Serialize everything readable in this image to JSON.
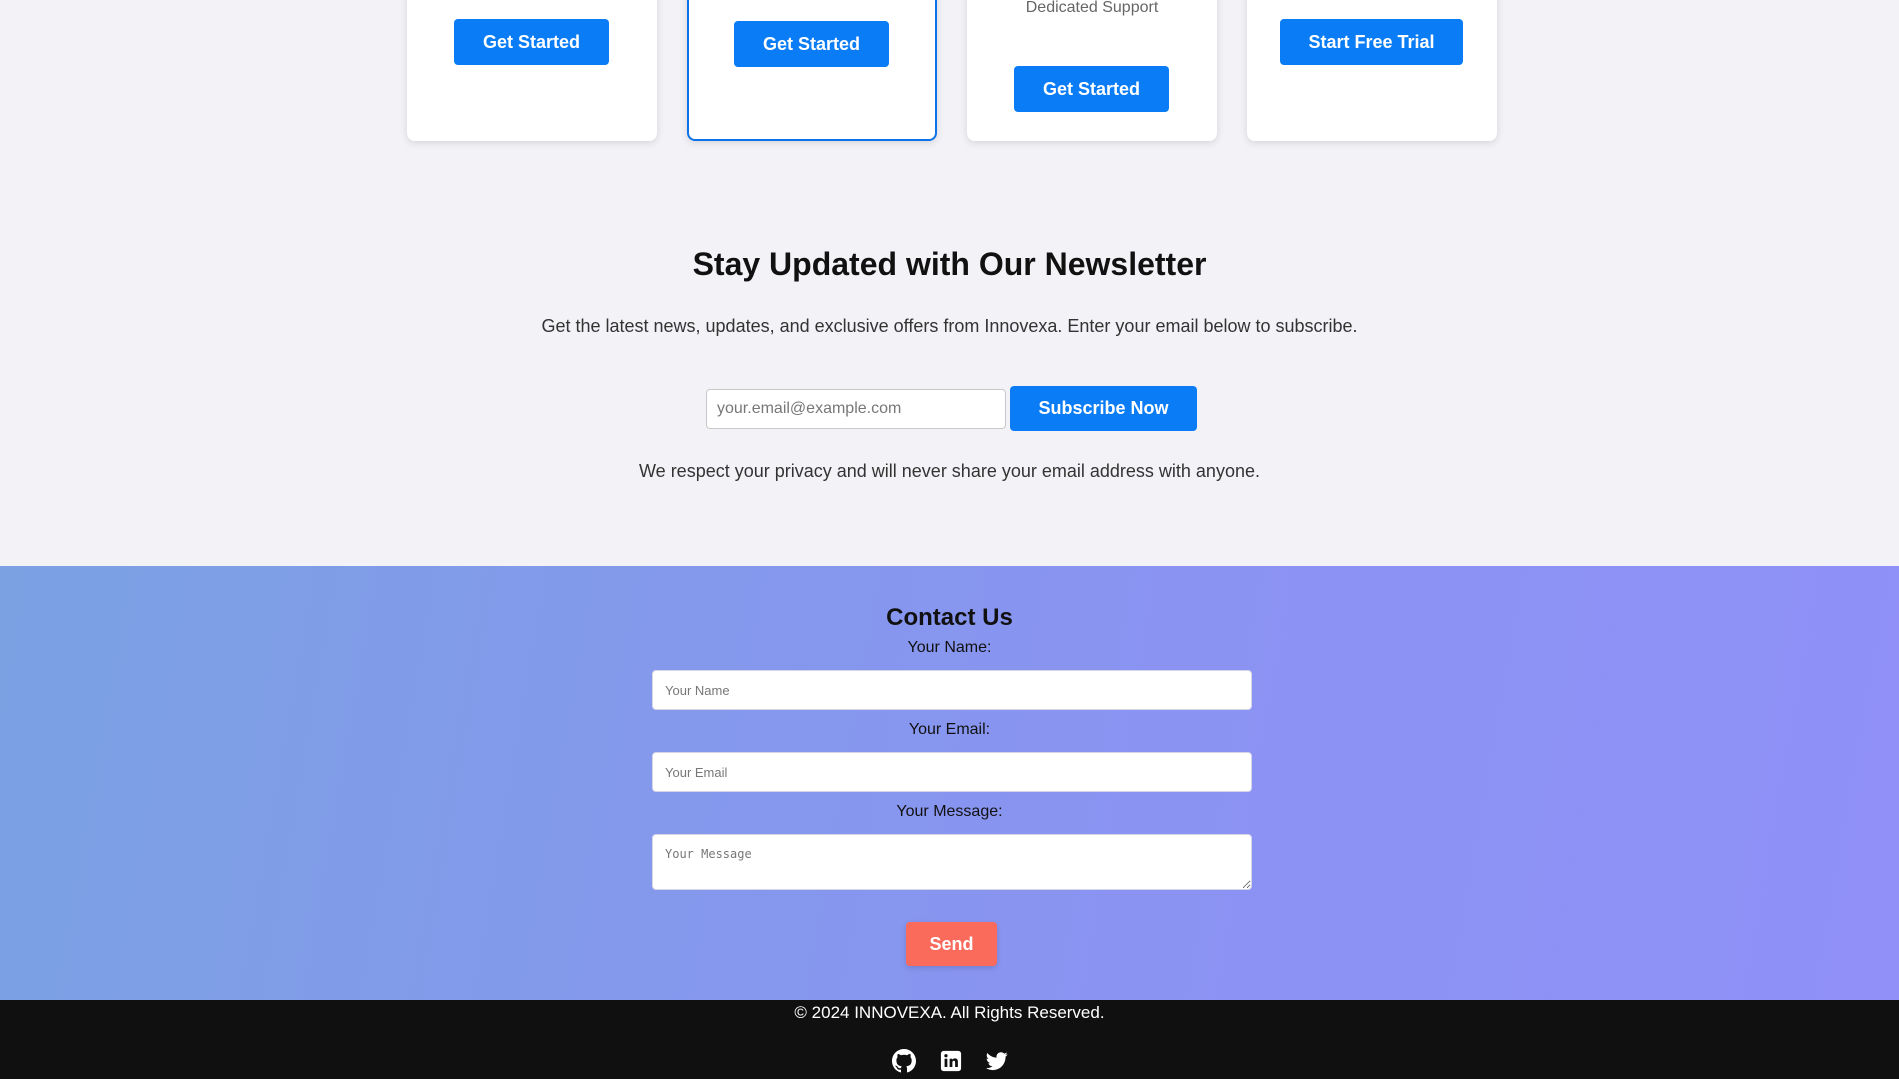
{
  "pricing": {
    "cards": [
      {
        "button_label": "Get Started"
      },
      {
        "button_label": "Get Started"
      },
      {
        "feature_visible": "Dedicated Support",
        "button_label": "Get Started"
      },
      {
        "button_label": "Start Free Trial"
      }
    ]
  },
  "newsletter": {
    "title": "Stay Updated with Our Newsletter",
    "description": "Get the latest news, updates, and exclusive offers from Innovexa. Enter your email below to subscribe.",
    "email_placeholder": "your.email@example.com",
    "subscribe_label": "Subscribe Now",
    "privacy_note": "We respect your privacy and will never share your email address with anyone."
  },
  "contact": {
    "title": "Contact Us",
    "name_label": "Your Name:",
    "name_placeholder": "Your Name",
    "email_label": "Your Email:",
    "email_placeholder": "Your Email",
    "message_label": "Your Message:",
    "message_placeholder": "Your Message",
    "send_label": "Send"
  },
  "footer": {
    "copyright": "© 2024 INNOVEXA. All Rights Reserved.",
    "social_icons": [
      "github-icon",
      "linkedin-icon",
      "twitter-icon"
    ]
  },
  "colors": {
    "primary_button": "#0a7cf5",
    "send_button": "#fb6b5b",
    "footer_bg": "#101010",
    "contact_gradient_start": "#7ba1e3",
    "contact_gradient_end": "#9090f8"
  }
}
